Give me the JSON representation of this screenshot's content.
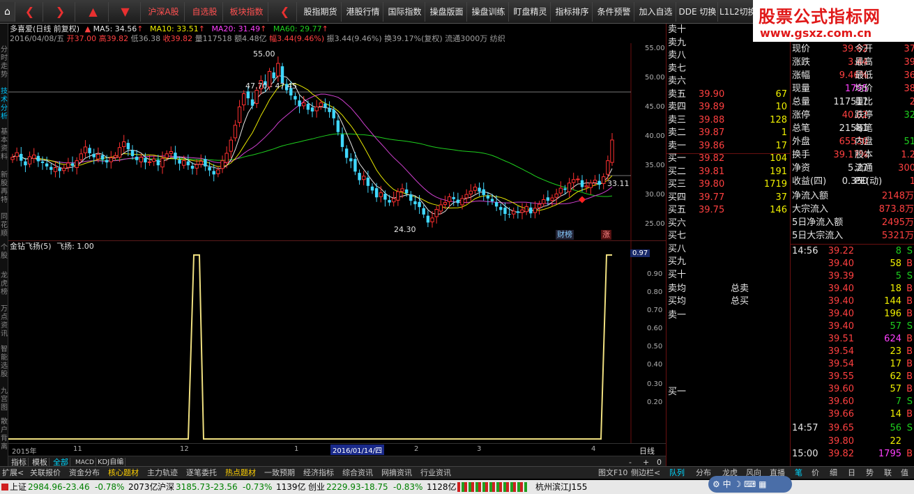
{
  "toolbar": {
    "buttons": [
      "沪深A股",
      "自选股",
      "板块指数",
      "股指期货",
      "港股行情",
      "国际指数",
      "操盘版面",
      "操盘训练",
      "盯盘精灵",
      "指标排序",
      "条件预警",
      "加入自选",
      "DDE 切换",
      "L1L2切换"
    ]
  },
  "brand": {
    "title": "股票公式指标网",
    "url": "www.gsxz.com.cn"
  },
  "left_tabs": [
    "分时走势",
    "技术分析",
    "基本资料",
    "新股再特",
    "同花顺",
    "个股",
    "龙虎榜",
    "万点资讯",
    "智能选股",
    "九宫图",
    "散户背离"
  ],
  "chart": {
    "title": "多喜爱(日线 前复权)",
    "ma": [
      {
        "label": "MA5: 34.56",
        "color": "#e8e8e8"
      },
      {
        "label": "MA10: 33.51",
        "color": "#f0f000"
      },
      {
        "label": "MA20: 31.49",
        "color": "#ff40ff"
      },
      {
        "label": "MA60: 29.77",
        "color": "#1ed01e"
      }
    ],
    "info": {
      "date": "2016/04/08/五",
      "open": "开37.00",
      "high": "高39.82",
      "low": "低36.38",
      "close": "收39.82",
      "volume": "量117518",
      "amount": "额4.48亿",
      "pct": "幅3.44(9.46%)",
      "amp": "振3.44(9.46%)",
      "turnover": "换39.17%(复权)",
      "float": "流通3000万",
      "industry": "纺织"
    },
    "annot_high": "55.00",
    "annot_mid": "47.70 - 47.45",
    "annot_low": "24.30",
    "annot_last": "33.11",
    "badge1": "财榜",
    "badge2": "涨",
    "price_axis": [
      "55.00",
      "50.00",
      "45.00",
      "40.00",
      "35.00",
      "30.00",
      "25.00"
    ],
    "indicator_title": "金钻飞扬(5)",
    "indicator_value": "飞扬: 1.00",
    "ind_axis": [
      "0.90",
      "0.80",
      "0.70",
      "0.60",
      "0.50",
      "0.40",
      "0.30",
      "0.20"
    ],
    "ind_last": "0.97",
    "time_axis": [
      "2015年",
      "11",
      "12",
      "1",
      "2016/01/14/四",
      "2",
      "3",
      "4"
    ],
    "period": "日线"
  },
  "chart_data": {
    "type": "line",
    "title": "金钻飞扬(5)",
    "x": [
      "2015年",
      "11",
      "12",
      "1",
      "2",
      "3",
      "4"
    ],
    "series": [
      {
        "name": "飞扬",
        "values": [
          0,
          0,
          1,
          0,
          0,
          0,
          0,
          1
        ]
      }
    ],
    "ylim": [
      0,
      1
    ]
  },
  "orderbook": {
    "sells": [
      {
        "lbl": "卖十",
        "p": "",
        "v": ""
      },
      {
        "lbl": "卖九",
        "p": "",
        "v": ""
      },
      {
        "lbl": "卖八",
        "p": "",
        "v": ""
      },
      {
        "lbl": "卖七",
        "p": "",
        "v": ""
      },
      {
        "lbl": "卖六",
        "p": "",
        "v": ""
      },
      {
        "lbl": "卖五",
        "p": "39.90",
        "v": "67"
      },
      {
        "lbl": "卖四",
        "p": "39.89",
        "v": "10"
      },
      {
        "lbl": "卖三",
        "p": "39.88",
        "v": "128"
      },
      {
        "lbl": "卖二",
        "p": "39.87",
        "v": "1"
      },
      {
        "lbl": "卖一",
        "p": "39.86",
        "v": "17"
      }
    ],
    "buys": [
      {
        "lbl": "买一",
        "p": "39.82",
        "v": "104"
      },
      {
        "lbl": "买二",
        "p": "39.81",
        "v": "191"
      },
      {
        "lbl": "买三",
        "p": "39.80",
        "v": "1719"
      },
      {
        "lbl": "买四",
        "p": "39.77",
        "v": "37"
      },
      {
        "lbl": "买五",
        "p": "39.75",
        "v": "146"
      },
      {
        "lbl": "买六",
        "p": "",
        "v": ""
      },
      {
        "lbl": "买七",
        "p": "",
        "v": ""
      },
      {
        "lbl": "买八",
        "p": "",
        "v": ""
      },
      {
        "lbl": "买九",
        "p": "",
        "v": ""
      },
      {
        "lbl": "买十",
        "p": "",
        "v": ""
      }
    ],
    "avg_sell": "卖均",
    "avg_buy": "买均",
    "total_sell": "总卖",
    "total_buy": "总买",
    "buy1": "卖一",
    "buy1b": "买一"
  },
  "quote": [
    {
      "k": "现价",
      "v": "39.82",
      "k2": "今开",
      "v2": "37"
    },
    {
      "k": "涨跌",
      "v": "3.44",
      "k2": "最高",
      "v2": "39"
    },
    {
      "k": "涨幅",
      "v": "9.46%",
      "k2": "最低",
      "v2": "36"
    },
    {
      "k": "现量",
      "v": "1795",
      "k2": "均价",
      "v2": "38"
    },
    {
      "k": "总量",
      "v": "117517",
      "k2": "量比",
      "v2": "2"
    },
    {
      "k": "涨停",
      "v": "40.02",
      "k2": "跌停",
      "v2": "32"
    },
    {
      "k": "总笔",
      "v": "21581",
      "k2": "每笔",
      "v2": ""
    },
    {
      "k": "外盘",
      "v": "65530",
      "k2": "内盘",
      "v2": "51"
    },
    {
      "k": "换手",
      "v": "39.17%",
      "k2": "股本",
      "v2": "1.2"
    },
    {
      "k": "净资",
      "v": "5.27",
      "k2": "流通",
      "v2": "300"
    },
    {
      "k": "收益(四)",
      "v": "0.350",
      "k2": "PE(动)",
      "v2": "1"
    }
  ],
  "flows": [
    {
      "k": "净流入额",
      "v": "2148万"
    },
    {
      "k": "大宗流入",
      "v": "873.8万"
    },
    {
      "k": "5日净流入额",
      "v": "2495万"
    },
    {
      "k": "5日大宗流入",
      "v": "5321万"
    }
  ],
  "ticks": [
    {
      "t": "14:56",
      "p": "39.22",
      "v": "8",
      "s": "S"
    },
    {
      "t": "",
      "p": "39.40",
      "v": "58",
      "s": "B"
    },
    {
      "t": "",
      "p": "39.39",
      "v": "5",
      "s": "S"
    },
    {
      "t": "",
      "p": "39.40",
      "v": "18",
      "s": "B"
    },
    {
      "t": "",
      "p": "39.40",
      "v": "144",
      "s": "B"
    },
    {
      "t": "",
      "p": "39.40",
      "v": "196",
      "s": "B"
    },
    {
      "t": "",
      "p": "39.40",
      "v": "57",
      "s": "S"
    },
    {
      "t": "",
      "p": "39.51",
      "v": "624",
      "s": "B"
    },
    {
      "t": "",
      "p": "39.54",
      "v": "23",
      "s": "B"
    },
    {
      "t": "",
      "p": "39.54",
      "v": "17",
      "s": "B"
    },
    {
      "t": "",
      "p": "39.55",
      "v": "62",
      "s": "B"
    },
    {
      "t": "",
      "p": "39.60",
      "v": "57",
      "s": "B"
    },
    {
      "t": "",
      "p": "39.60",
      "v": "7",
      "s": "S"
    },
    {
      "t": "",
      "p": "39.66",
      "v": "14",
      "s": "B"
    },
    {
      "t": "14:57",
      "p": "39.65",
      "v": "56",
      "s": "S"
    },
    {
      "t": "",
      "p": "39.80",
      "v": "22",
      "s": ""
    },
    {
      "t": "15:00",
      "p": "39.82",
      "v": "1795",
      "s": "B"
    }
  ],
  "bottom_tabs": [
    "指标",
    "模板",
    "全部",
    "MACD",
    "KDJ自编"
  ],
  "bottom_bar": [
    "扩展<",
    "关联报价",
    "资金分布",
    "核心题材",
    "主力轨迹",
    "逐笔委托",
    "热点题材",
    "一致预期",
    "经济指标",
    "综合资讯",
    "网摘资讯",
    "行业资讯"
  ],
  "bottom_right": [
    "图文F10",
    "侧边栏<",
    "队列",
    "分布",
    "龙虎",
    "风向",
    "直播",
    "笔",
    "价",
    "细",
    "日",
    "势",
    "联",
    "值"
  ],
  "status": {
    "sh": "上证",
    "sh_v": "2984.96",
    "sh_c": "-23.46",
    "sh_p": "-0.78%",
    "sh_a": "2073亿",
    "sz": "沪深",
    "sz_v": "3185.73",
    "sz_c": "-23.56",
    "sz_p": "-0.73%",
    "sz_a": "1139亿",
    "cy": "创业",
    "cy_v": "2229.93",
    "cy_c": "-18.75",
    "cy_p": "-0.83%",
    "cy_a": "1128亿",
    "loc": "杭州滨江J155"
  }
}
